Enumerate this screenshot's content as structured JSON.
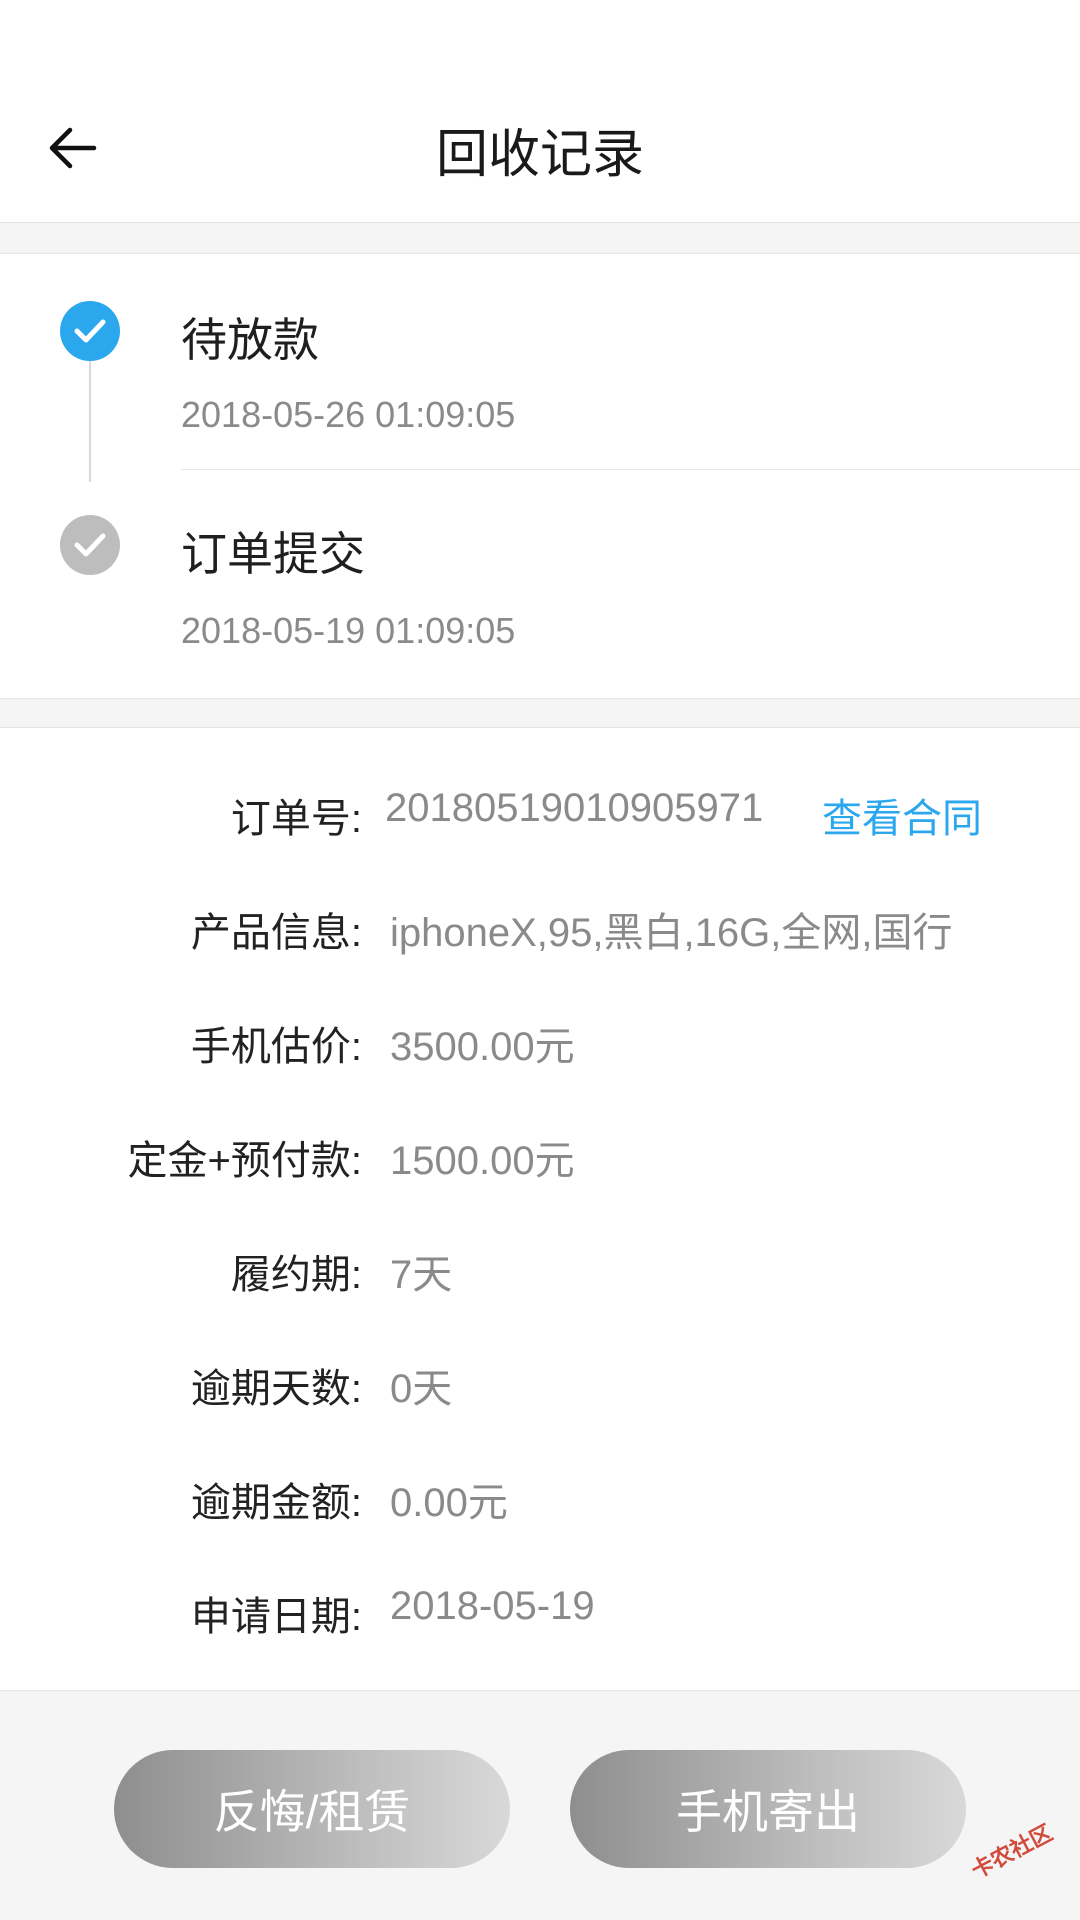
{
  "header": {
    "title": "回收记录",
    "back_icon": "arrow-left-icon"
  },
  "timeline": {
    "steps": [
      {
        "title": "待放款",
        "time": "2018-05-26 01:09:05",
        "status": "active",
        "color": "#2ba7ee"
      },
      {
        "title": "订单提交",
        "time": "2018-05-19 01:09:05",
        "status": "done",
        "color": "#bdbdbd"
      }
    ]
  },
  "details": {
    "rows": [
      {
        "label": "订单号:",
        "value": "20180519010905971"
      },
      {
        "label": "产品信息:",
        "value": "iphoneX,95,黑白,16G,全网,国行"
      },
      {
        "label": "手机估价:",
        "value": "3500.00元"
      },
      {
        "label": "定金+预付款:",
        "value": "1500.00元"
      },
      {
        "label": "履约期:",
        "value": "7天"
      },
      {
        "label": "逾期天数:",
        "value": "0天"
      },
      {
        "label": "逾期金额:",
        "value": "0.00元"
      },
      {
        "label": "申请日期:",
        "value": "2018-05-19"
      }
    ],
    "contract_link": "查看合同"
  },
  "actions": {
    "regret_label": "反悔/租赁",
    "ship_label": "手机寄出"
  },
  "watermark": {
    "text": "卡农社区"
  },
  "colors": {
    "accent": "#2ba7ee",
    "muted": "#8a8a8a",
    "button_gray": "#a8a8a8"
  }
}
